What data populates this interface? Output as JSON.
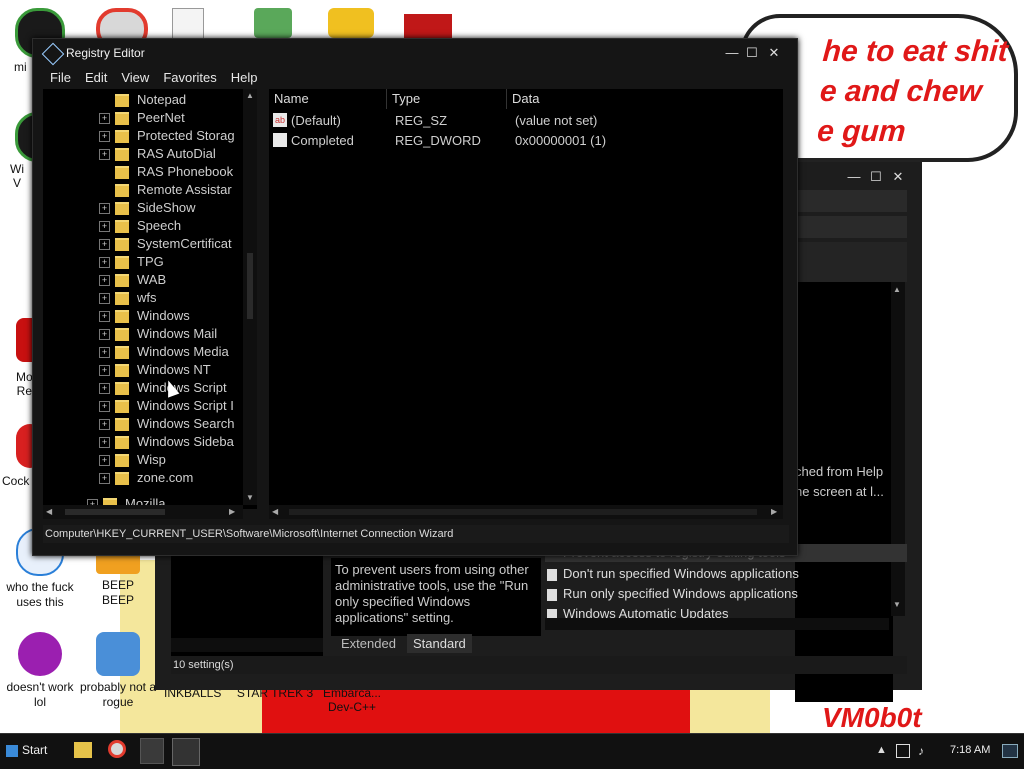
{
  "desktop": {
    "bubble_lines": [
      "he to eat shit",
      "e and chew",
      "e gum"
    ],
    "watermark": "VM0b0t",
    "icons": [
      {
        "label": "mi",
        "color": "#1a1a1a"
      },
      {
        "label": "Wi\nV",
        "color": "#1a1a1a"
      },
      {
        "label": "Mo\nRe",
        "color": "#c81010"
      },
      {
        "label": "Cock",
        "color": "#d82020"
      },
      {
        "label": "who the fuck uses this",
        "color": "#2a7fd8"
      },
      {
        "label": "BEEP BEEP",
        "color": "#f0a020"
      },
      {
        "label": "doesn't work lol",
        "color": "#9b1fb0"
      },
      {
        "label": "probably not a rogue",
        "color": "#4a8fd8"
      }
    ],
    "partial_labels": [
      "INKBALLS",
      "STAR TREK 3",
      "Embarca... Dev-C++"
    ]
  },
  "back_window": {
    "help_text": "To prevent users from using other administrative tools, use the \"Run only specified Windows applications\" setting.",
    "settings": [
      "Prevent access to registry editing tools",
      "Don't run specified Windows applications",
      "Run only specified Windows applications",
      "Windows Automatic Updates"
    ],
    "right_text": [
      "ched from Help",
      "he screen at l..."
    ],
    "tabs": [
      "Extended",
      "Standard"
    ],
    "status": "10 setting(s)"
  },
  "registry": {
    "title": "Registry Editor",
    "menu": [
      "File",
      "Edit",
      "View",
      "Favorites",
      "Help"
    ],
    "tree": [
      {
        "label": "Notepad",
        "plus": false
      },
      {
        "label": "PeerNet",
        "plus": true
      },
      {
        "label": "Protected Storag",
        "plus": true
      },
      {
        "label": "RAS AutoDial",
        "plus": true
      },
      {
        "label": "RAS Phonebook",
        "plus": false
      },
      {
        "label": "Remote Assistar",
        "plus": false
      },
      {
        "label": "SideShow",
        "plus": true
      },
      {
        "label": "Speech",
        "plus": true
      },
      {
        "label": "SystemCertificat",
        "plus": true
      },
      {
        "label": "TPG",
        "plus": true
      },
      {
        "label": "WAB",
        "plus": true
      },
      {
        "label": "wfs",
        "plus": true
      },
      {
        "label": "Windows",
        "plus": true
      },
      {
        "label": "Windows Mail",
        "plus": true
      },
      {
        "label": "Windows Media",
        "plus": true
      },
      {
        "label": "Windows NT",
        "plus": true
      },
      {
        "label": "Windows Script",
        "plus": true
      },
      {
        "label": "Windows Script I",
        "plus": true
      },
      {
        "label": "Windows Search",
        "plus": true
      },
      {
        "label": "Windows Sideba",
        "plus": true
      },
      {
        "label": "Wisp",
        "plus": true
      },
      {
        "label": "zone.com",
        "plus": true
      }
    ],
    "tree_parent": "Mozilla",
    "columns": [
      "Name",
      "Type",
      "Data"
    ],
    "values": [
      {
        "icon": "ab",
        "name": "(Default)",
        "type": "REG_SZ",
        "data": "(value not set)"
      },
      {
        "icon": "dword",
        "name": "Completed",
        "type": "REG_DWORD",
        "data": "0x00000001 (1)"
      }
    ],
    "status": "Computer\\HKEY_CURRENT_USER\\Software\\Microsoft\\Internet Connection Wizard"
  },
  "taskbar": {
    "start": "Start",
    "time": "7:18 AM",
    "pinned": [
      "folder-icon",
      "chrome-icon",
      "media-icon",
      "regedit-icon"
    ]
  }
}
